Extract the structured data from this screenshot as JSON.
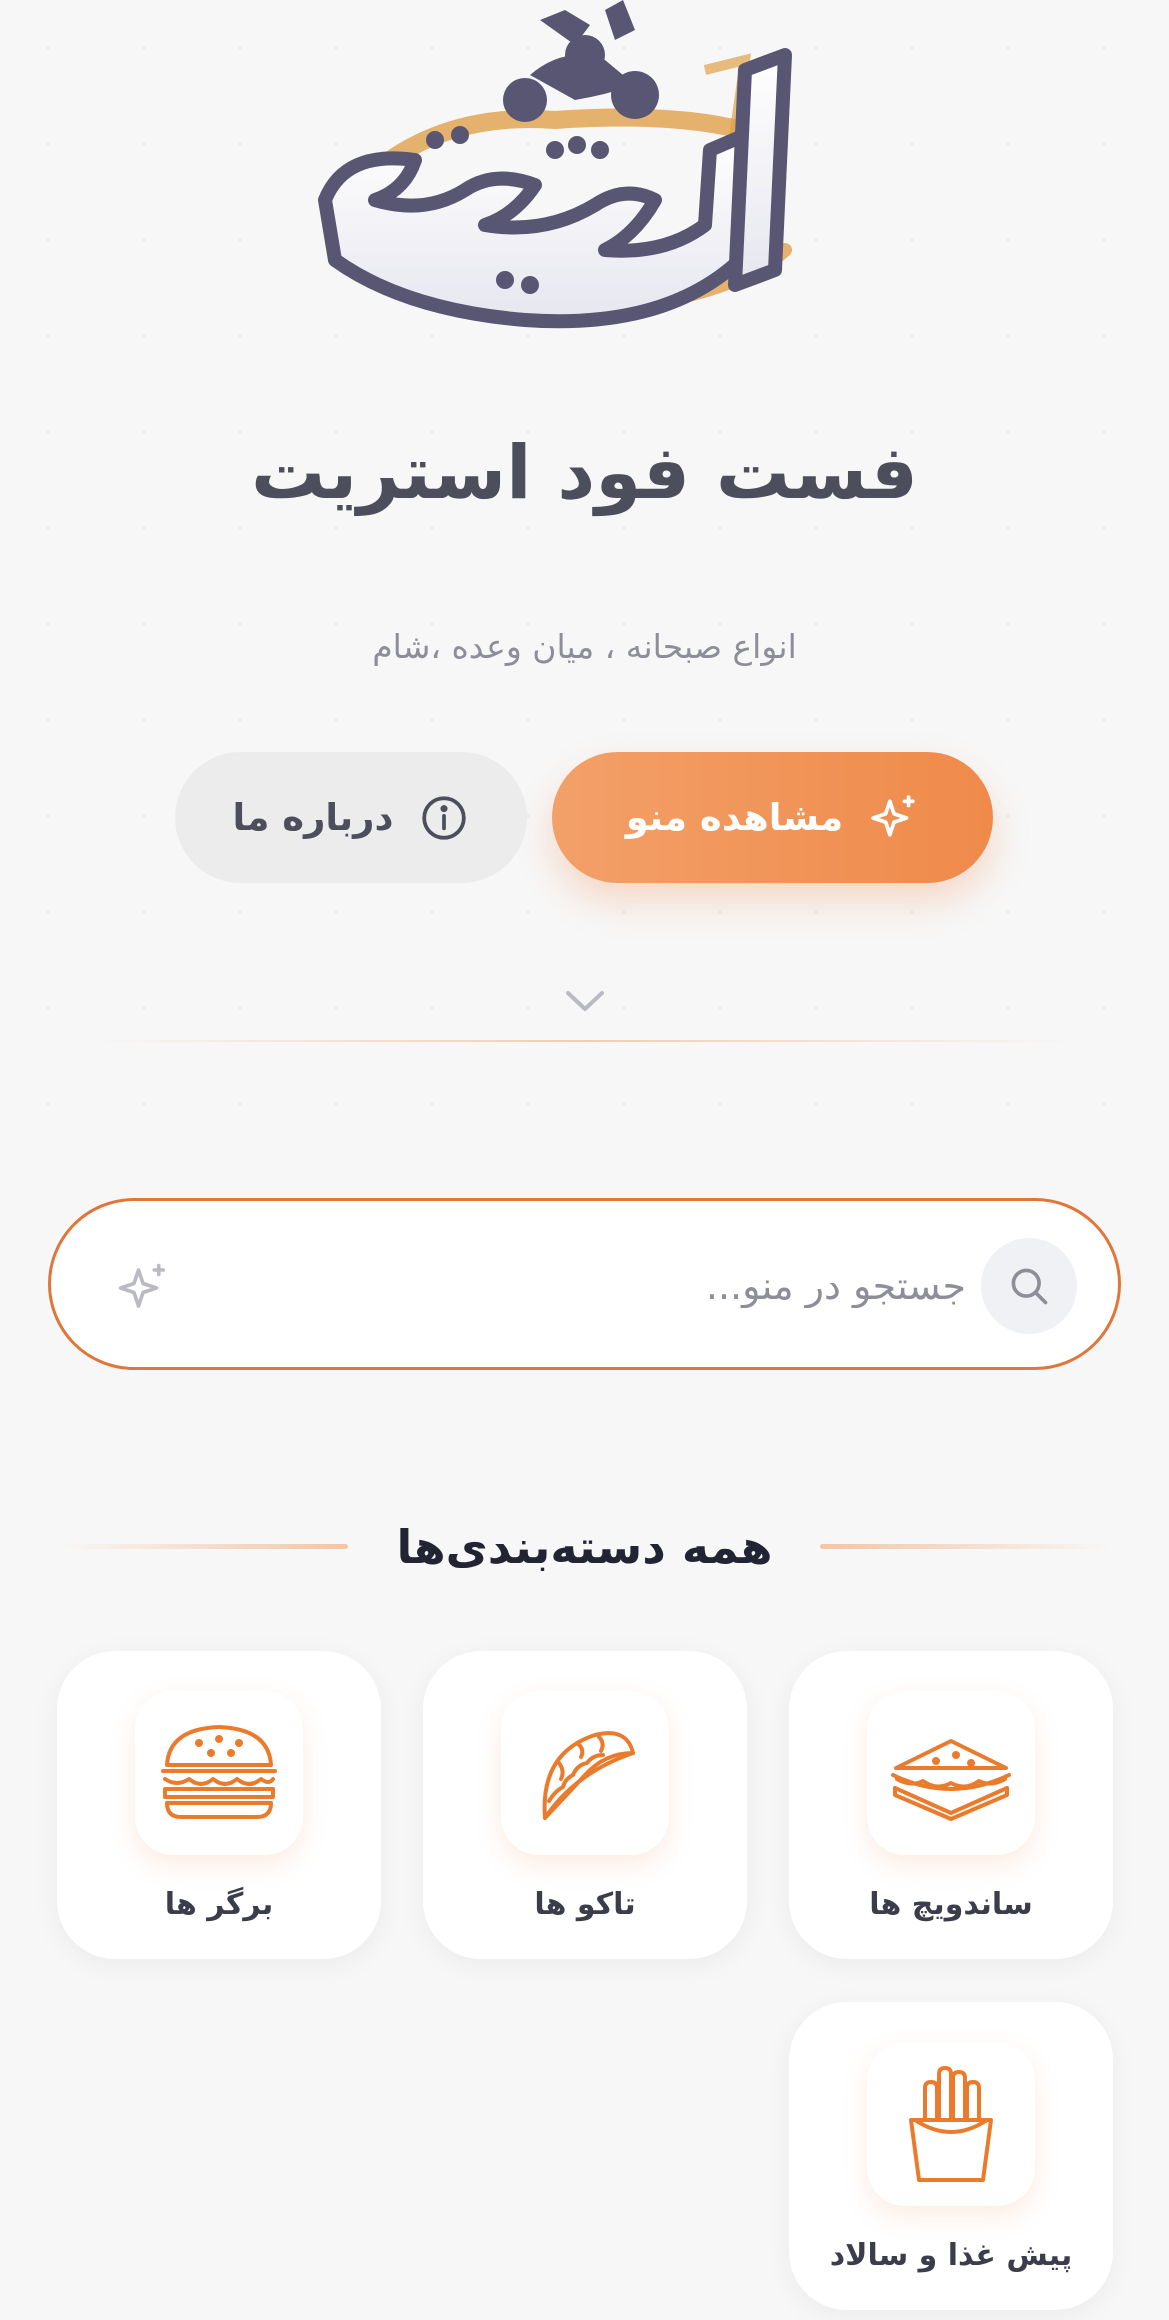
{
  "brand": {
    "title": "فست فود استریت",
    "subtitle": "انواع صبحانه ، میان وعده ،شام",
    "logo_text": "استریت"
  },
  "actions": {
    "view_menu_label": "مشاهده منو",
    "about_label": "درباره ما"
  },
  "search": {
    "placeholder": "جستجو در منو..."
  },
  "categories": {
    "heading": "همه دسته‌بندی‌ها",
    "items": [
      {
        "label": "ساندویچ ها",
        "icon": "sandwich-icon"
      },
      {
        "label": "تاکو ها",
        "icon": "taco-icon"
      },
      {
        "label": "برگر ها",
        "icon": "burger-icon"
      },
      {
        "label": "پیش غذا و سالاد",
        "icon": "fries-icon"
      }
    ]
  },
  "colors": {
    "accent": "#ef8a4a",
    "accent_light": "#f3a069",
    "text_dark": "#4d4e5c",
    "text_muted": "#8d8e98",
    "background": "#f7f7f7"
  }
}
